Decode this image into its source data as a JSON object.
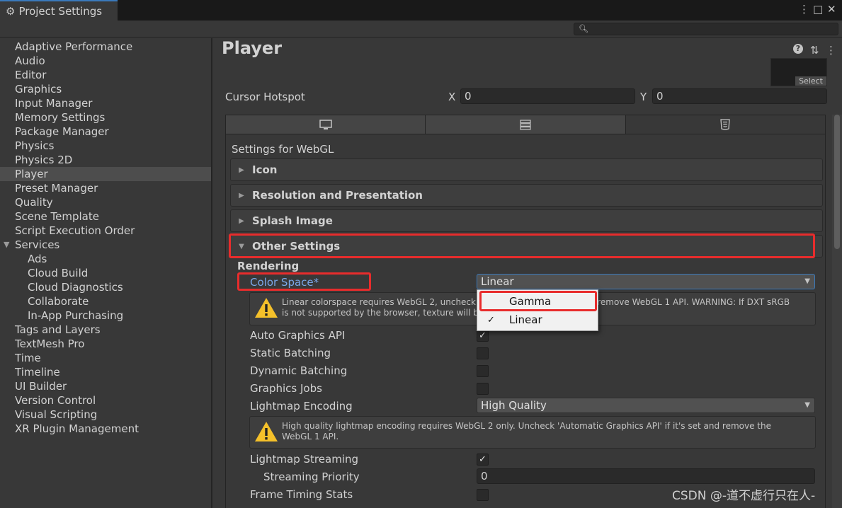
{
  "window": {
    "tab_title": "Project Settings",
    "gear_glyph": "⚙",
    "menu_glyph": "⋮",
    "maximize_glyph": "□",
    "close_glyph": "✕"
  },
  "search": {
    "placeholder": "",
    "icon": "search-icon"
  },
  "sidebar": {
    "items": [
      {
        "label": "Adaptive Performance"
      },
      {
        "label": "Audio"
      },
      {
        "label": "Editor"
      },
      {
        "label": "Graphics"
      },
      {
        "label": "Input Manager"
      },
      {
        "label": "Memory Settings"
      },
      {
        "label": "Package Manager"
      },
      {
        "label": "Physics"
      },
      {
        "label": "Physics 2D"
      },
      {
        "label": "Player"
      },
      {
        "label": "Preset Manager"
      },
      {
        "label": "Quality"
      },
      {
        "label": "Scene Template"
      },
      {
        "label": "Script Execution Order"
      },
      {
        "label": "Services"
      },
      {
        "label": "Ads"
      },
      {
        "label": "Cloud Build"
      },
      {
        "label": "Cloud Diagnostics"
      },
      {
        "label": "Collaborate"
      },
      {
        "label": "In-App Purchasing"
      },
      {
        "label": "Tags and Layers"
      },
      {
        "label": "TextMesh Pro"
      },
      {
        "label": "Time"
      },
      {
        "label": "Timeline"
      },
      {
        "label": "UI Builder"
      },
      {
        "label": "Version Control"
      },
      {
        "label": "Visual Scripting"
      },
      {
        "label": "XR Plugin Management"
      }
    ],
    "selected": "Player",
    "fold_glyph": "▼"
  },
  "main": {
    "title": "Player",
    "help_glyph": "?",
    "preset_glyph": "⇅",
    "more_glyph": "⋮",
    "preview_select_label": "Select",
    "cursor_hotspot": {
      "label": "Cursor Hotspot",
      "x_label": "X",
      "x_value": "0",
      "y_label": "Y",
      "y_value": "0"
    },
    "platform_tabs": [
      {
        "icon": "monitor-icon"
      },
      {
        "icon": "server-icon"
      },
      {
        "icon": "html5-icon",
        "active": true
      }
    ],
    "settings_for": "Settings for WebGL",
    "foldouts": {
      "icon": "Icon",
      "resolution": "Resolution and Presentation",
      "splash": "Splash Image",
      "other": "Other Settings"
    },
    "collapsed_arrow": "▶",
    "expanded_arrow": "▼",
    "rendering_header": "Rendering",
    "color_space": {
      "label": "Color Space*",
      "value": "Linear"
    },
    "color_space_warning": "Linear colorspace requires WebGL 2, uncheck 'Automatic Graphics API' to remove WebGL 1 API. WARNING: If DXT sRGB is not supported by the browser, texture will be decompressed",
    "auto_graphics_api": {
      "label": "Auto Graphics API",
      "checked": true
    },
    "static_batching": {
      "label": "Static Batching",
      "checked": false
    },
    "dynamic_batching": {
      "label": "Dynamic Batching",
      "checked": false
    },
    "graphics_jobs": {
      "label": "Graphics Jobs",
      "checked": false
    },
    "lightmap_encoding": {
      "label": "Lightmap Encoding",
      "value": "High Quality"
    },
    "lightmap_warning": "High quality lightmap encoding requires WebGL 2 only. Uncheck 'Automatic Graphics API' if it's set and remove the WebGL 1 API.",
    "lightmap_streaming": {
      "label": "Lightmap Streaming",
      "checked": true
    },
    "streaming_priority": {
      "label": "Streaming Priority",
      "value": "0"
    },
    "frame_timing_stats": {
      "label": "Frame Timing Stats",
      "checked": false
    },
    "check_glyph": "✓",
    "caret_glyph": "▼"
  },
  "popup": {
    "options": [
      {
        "label": "Gamma",
        "checked": false
      },
      {
        "label": "Linear",
        "checked": true
      }
    ],
    "check_glyph": "✓"
  },
  "watermark": "CSDN @-道不虚行只在人-",
  "colors": {
    "accent": "#3a79bb",
    "highlight_red": "#e82c2c",
    "link_blue": "#7aa7e8",
    "warning_yellow": "#f4c02a"
  }
}
